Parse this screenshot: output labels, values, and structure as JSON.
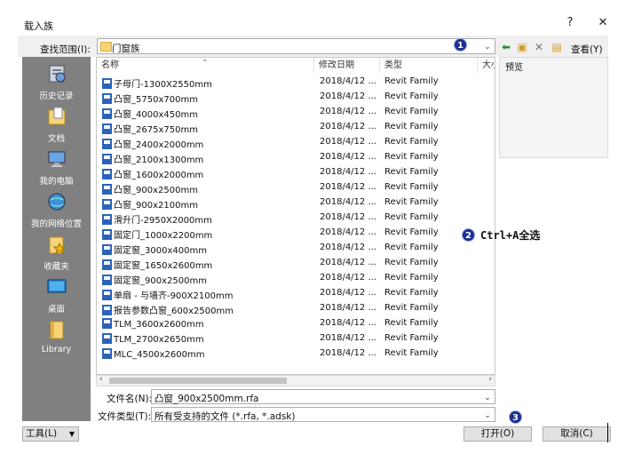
{
  "window": {
    "title": "载入族",
    "help": "?",
    "close": "✕"
  },
  "lookin": {
    "label": "查找范围(I):",
    "value": "门窗族"
  },
  "tools": {
    "view": "查看(Y)",
    "preview_label": "预览"
  },
  "places": [
    {
      "label": "历史记录",
      "icon": "history-icon"
    },
    {
      "label": "文档",
      "icon": "documents-icon"
    },
    {
      "label": "我的电脑",
      "icon": "computer-icon"
    },
    {
      "label": "我的网络位置",
      "icon": "network-icon"
    },
    {
      "label": "收藏夹",
      "icon": "favorites-icon"
    },
    {
      "label": "桌面",
      "icon": "desktop-icon"
    },
    {
      "label": "Library",
      "icon": "library-icon"
    }
  ],
  "columns": {
    "name": "名称",
    "date": "修改日期",
    "type": "类型",
    "size": "大小"
  },
  "files": [
    {
      "name": "子母门-1300X2550mm",
      "date": "2018/4/12 ...",
      "type": "Revit Family"
    },
    {
      "name": "凸窗_5750x700mm",
      "date": "2018/4/12 ...",
      "type": "Revit Family"
    },
    {
      "name": "凸窗_4000x450mm",
      "date": "2018/4/12 ...",
      "type": "Revit Family"
    },
    {
      "name": "凸窗_2675x750mm",
      "date": "2018/4/12 ...",
      "type": "Revit Family"
    },
    {
      "name": "凸窗_2400x2000mm",
      "date": "2018/4/12 ...",
      "type": "Revit Family"
    },
    {
      "name": "凸窗_2100x1300mm",
      "date": "2018/4/12 ...",
      "type": "Revit Family"
    },
    {
      "name": "凸窗_1600x2000mm",
      "date": "2018/4/12 ...",
      "type": "Revit Family"
    },
    {
      "name": "凸窗_900x2500mm",
      "date": "2018/4/12 ...",
      "type": "Revit Family"
    },
    {
      "name": "凸窗_900x2100mm",
      "date": "2018/4/12 ...",
      "type": "Revit Family"
    },
    {
      "name": "滑升门-2950X2000mm",
      "date": "2018/4/12 ...",
      "type": "Revit Family"
    },
    {
      "name": "固定门_1000x2200mm",
      "date": "2018/4/12 ...",
      "type": "Revit Family"
    },
    {
      "name": "固定窗_3000x400mm",
      "date": "2018/4/12 ...",
      "type": "Revit Family"
    },
    {
      "name": "固定窗_1650x2600mm",
      "date": "2018/4/12 ...",
      "type": "Revit Family"
    },
    {
      "name": "固定窗_900x2500mm",
      "date": "2018/4/12 ...",
      "type": "Revit Family"
    },
    {
      "name": "单扇 - 与墙齐-900X2100mm",
      "date": "2018/4/12 ...",
      "type": "Revit Family"
    },
    {
      "name": "报告参数凸窗_600x2500mm",
      "date": "2018/4/12 ...",
      "type": "Revit Family"
    },
    {
      "name": "TLM_3600x2600mm",
      "date": "2018/4/12 ...",
      "type": "Revit Family"
    },
    {
      "name": "TLM_2700x2650mm",
      "date": "2018/4/12 ...",
      "type": "Revit Family"
    },
    {
      "name": "MLC_4500x2600mm",
      "date": "2018/4/12 ...",
      "type": "Revit Family"
    }
  ],
  "filename": {
    "label": "文件名(N):",
    "value": "凸窗_900x2500mm.rfa"
  },
  "filetype": {
    "label": "文件类型(T):",
    "value": "所有受支持的文件 (*.rfa, *.adsk)"
  },
  "buttons": {
    "tools": "工具(L)",
    "open": "打开(O)",
    "cancel": "取消(C)"
  },
  "callouts": {
    "c1": "1",
    "c2": "2",
    "c3": "3"
  },
  "annotation": "Ctrl+A全选",
  "colors": {
    "places_bg": "#808080",
    "callout": "#1c2f8e",
    "file_icon": "#2a63b8"
  }
}
